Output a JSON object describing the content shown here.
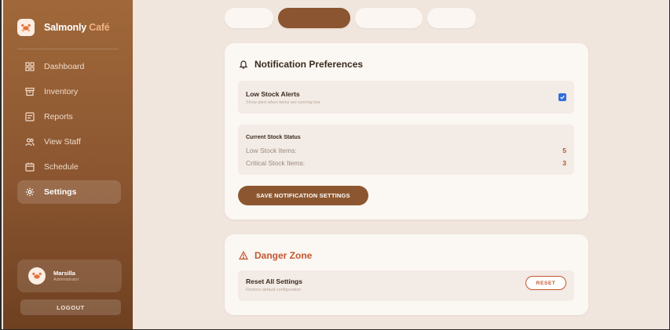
{
  "brand": {
    "name_main": "Salmonly",
    "name_accent": "Café",
    "logo_icon": "crab-logo-icon"
  },
  "nav": [
    {
      "label": "Dashboard",
      "icon": "dashboard-icon",
      "active": false
    },
    {
      "label": "Inventory",
      "icon": "inventory-icon",
      "active": false
    },
    {
      "label": "Reports",
      "icon": "reports-icon",
      "active": false
    },
    {
      "label": "View Staff",
      "icon": "staff-icon",
      "active": false
    },
    {
      "label": "Schedule",
      "icon": "calendar-icon",
      "active": false
    },
    {
      "label": "Settings",
      "icon": "gear-icon",
      "active": true
    }
  ],
  "user": {
    "name": "Marsilla",
    "role": "Administrator"
  },
  "logout_label": "LOGOUT",
  "notifications": {
    "title": "Notification Preferences",
    "low_stock": {
      "title": "Low Stock Alerts",
      "subtitle": "Show alert when items are running low",
      "checked": true
    },
    "status": {
      "heading": "Current Stock Status",
      "low_label": "Low Stock Items:",
      "low_value": "5",
      "critical_label": "Critical Stock Items:",
      "critical_value": "3"
    },
    "save_label": "SAVE NOTIFICATION SETTINGS"
  },
  "danger": {
    "title": "Danger Zone",
    "reset_title": "Reset All Settings",
    "reset_subtitle": "Restore default configuration",
    "reset_label": "RESET"
  },
  "colors": {
    "accent": "#8a5530",
    "danger": "#c4562f",
    "checkbox": "#2f6fdb"
  }
}
